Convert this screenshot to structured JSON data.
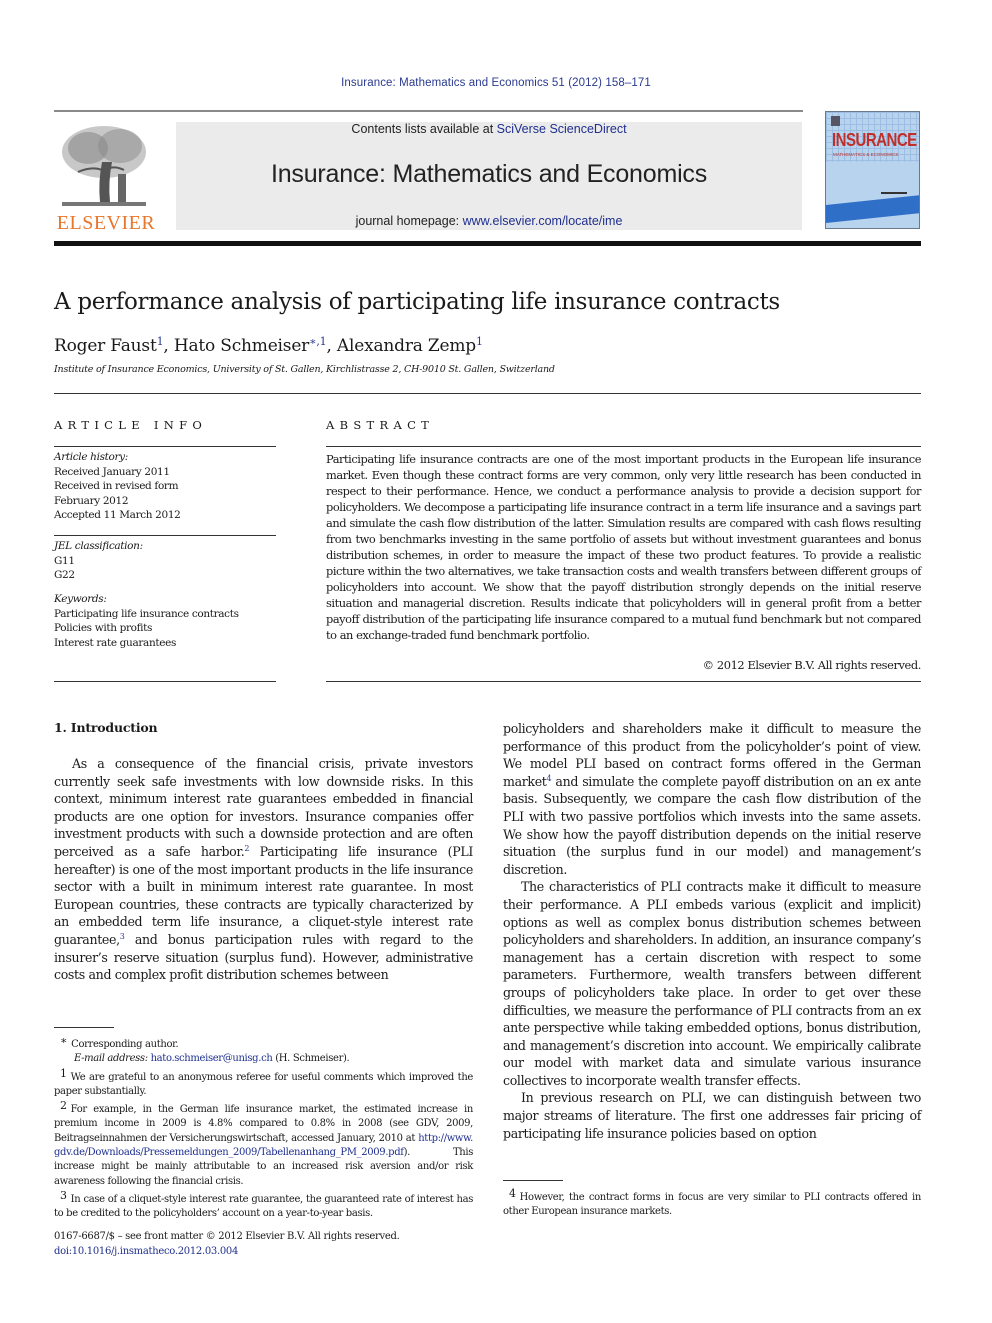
{
  "running_head": "Insurance: Mathematics and Economics 51 (2012) 158–171",
  "publisher": {
    "logo_word": "ELSEVIER",
    "logo_icon": "elsevier-tree-icon"
  },
  "masthead": {
    "contents_prefix": "Contents lists available at ",
    "contents_link": "SciVerse ScienceDirect",
    "journal_title": "Insurance: Mathematics and Economics",
    "homepage_prefix": "journal homepage: ",
    "homepage_link": "www.elsevier.com/locate/ime"
  },
  "cover": {
    "title": "INSURANCE",
    "subtitle": "MATHEMATICS & ECONOMICS"
  },
  "article": {
    "title": "A performance analysis of participating life insurance contracts",
    "authors": [
      {
        "name": "Roger Faust",
        "marks": "1"
      },
      {
        "name": "Hato Schmeiser",
        "marks": "∗,1"
      },
      {
        "name": "Alexandra Zemp",
        "marks": "1"
      }
    ],
    "affiliation": "Institute of Insurance Economics, University of St. Gallen, Kirchlistrasse 2, CH-9010 St. Gallen, Switzerland"
  },
  "article_info": {
    "heading": "ARTICLE INFO",
    "history_label": "Article history:",
    "history": [
      "Received January 2011",
      "Received in revised form",
      "February 2012",
      "Accepted 11 March 2012"
    ],
    "jel_label": "JEL classification:",
    "jel": [
      "G11",
      "G22"
    ],
    "keywords_label": "Keywords:",
    "keywords": [
      "Participating life insurance contracts",
      "Policies with profits",
      "Interest rate guarantees"
    ]
  },
  "abstract": {
    "heading": "ABSTRACT",
    "text": "Participating life insurance contracts are one of the most important products in the European life insurance market. Even though these contract forms are very common, only very little research has been conducted in respect to their performance. Hence, we conduct a performance analysis to provide a decision support for policyholders. We decompose a participating life insurance contract in a term life insurance and a savings part and simulate the cash flow distribution of the latter. Simulation results are compared with cash flows resulting from two benchmarks investing in the same portfolio of assets but without investment guarantees and bonus distribution schemes, in order to measure the impact of these two product features. To provide a realistic picture within the two alternatives, we take transaction costs and wealth transfers between different groups of policyholders into account. We show that the payoff distribution strongly depends on the initial reserve situation and managerial discretion. Results indicate that policyholders will in general profit from a better payoff distribution of the participating life insurance compared to a mutual fund benchmark but not compared to an exchange-traded fund benchmark portfolio.",
    "copyright": "© 2012 Elsevier B.V. All rights reserved."
  },
  "introduction": {
    "heading": "1.  Introduction",
    "left_p1_a": "As a consequence of the financial crisis, private investors currently seek safe investments with low downside risks. In this context, minimum interest rate guarantees embedded in financial products are one option for investors. Insurance companies offer investment products with such a downside protection and are often perceived as a safe harbor.",
    "left_p1_fn2": "2",
    "left_p1_b": " Participating life insurance (PLI hereafter) is one of the most important products in the life insurance sector with a built in minimum interest rate guarantee. In most European countries, these contracts are typically characterized by an embedded term life insurance, a cliquet-style interest rate guarantee,",
    "left_p1_fn3": "3",
    "left_p1_c": " and bonus participation rules with regard to the insurer’s reserve situation (surplus fund). However, administrative costs and complex profit distribution schemes between",
    "right_p1_a": "policyholders and shareholders make it difficult to measure the performance of this product from the policyholder’s point of view. We model PLI based on contract forms offered in the German market",
    "right_p1_fn4": "4",
    "right_p1_b": " and simulate the complete payoff distribution on an ex ante basis. Subsequently, we compare the cash flow distribution of the PLI with two passive portfolios which invests into the same assets. We show how the payoff distribution depends on the initial reserve situation (the surplus fund in our model) and management’s discretion.",
    "right_p2": "The characteristics of PLI contracts make it difficult to measure their performance. A PLI embeds various (explicit and implicit) options as well as complex bonus distribution schemes between policyholders and shareholders. In addition, an insurance company’s management has a certain discretion with respect to some parameters. Furthermore, wealth transfers between different groups of policyholders take place. In order to get over these difficulties, we measure the performance of PLI contracts from an ex ante perspective while taking embedded options, bonus distribution, and management’s discretion into account. We empirically calibrate our model with market data and simulate various insurance collectives to incorporate wealth transfer effects.",
    "right_p3": "In previous research on PLI, we can distinguish between two major streams of literature. The first one addresses fair pricing of participating life insurance policies based on option"
  },
  "footnotes": {
    "corresponding_mark": "∗",
    "corresponding": "Corresponding author.",
    "email_label": "E-mail address:",
    "email": "hato.schmeiser@unisg.ch",
    "email_suffix": " (H. Schmeiser).",
    "fn1_mark": "1",
    "fn1": "We are grateful to an anonymous referee for useful comments which improved the paper substantially.",
    "fn2_mark": "2",
    "fn2_a": "For example, in the German life insurance market, the estimated increase in premium income in 2009 is 4.8% compared to 0.8% in 2008 (see GDV, 2009, Beitragseinnahmen der Versicherungswirtschaft, accessed January, 2010 at ",
    "fn2_link": "http://www.gdv.de/Downloads/Pressemeldungen_2009/Tabellenanhang_PM_2009.pdf",
    "fn2_b": "). This increase might be mainly attributable to an increased risk aversion and/or risk awareness following the financial crisis.",
    "fn3_mark": "3",
    "fn3": "In case of a cliquet-style interest rate guarantee, the guaranteed rate of interest has to be credited to the policyholders’ account on a year-to-year basis.",
    "fn4_mark": "4",
    "fn4": "However, the contract forms in focus are very similar to PLI contracts offered in other European insurance markets."
  },
  "front_matter": {
    "issn": "0167-6687/$ – see front matter © 2012 Elsevier B.V. All rights reserved.",
    "doi": "doi:10.1016/j.insmatheco.2012.03.004"
  }
}
